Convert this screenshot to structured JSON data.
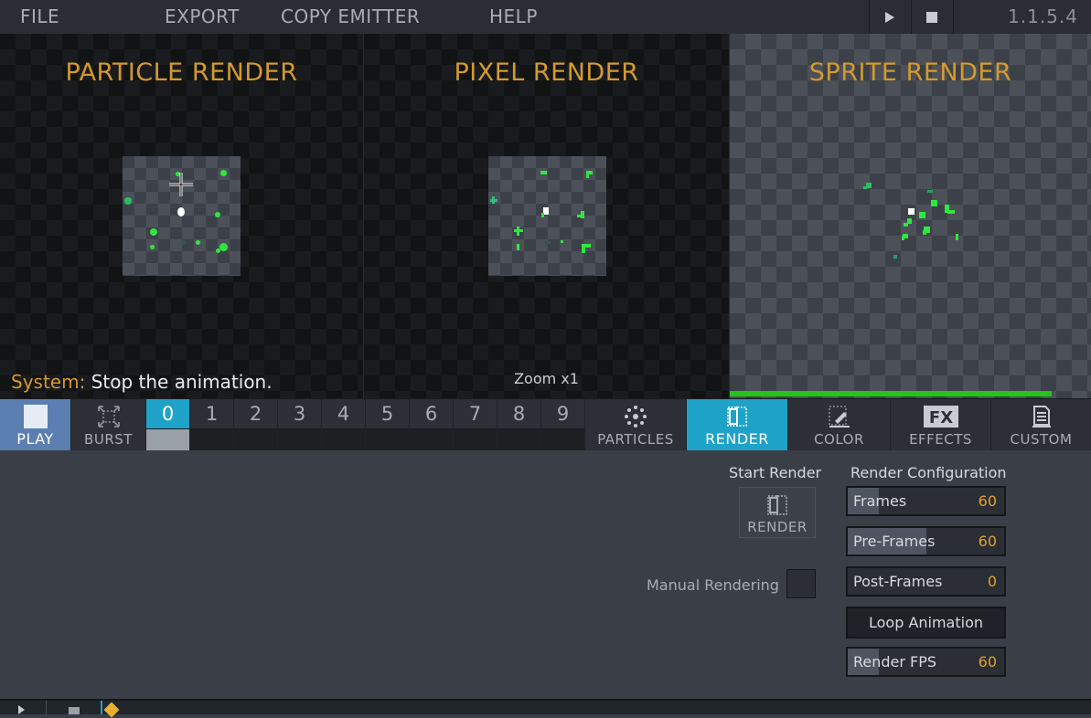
{
  "menu": {
    "file": "FILE",
    "export": "EXPORT",
    "copy_emitter": "COPY EMITTER",
    "help": "HELP",
    "version": "1.1.5.4",
    "play_icon": "play-icon",
    "stop_icon": "stop-icon"
  },
  "viewports": {
    "particle_title": "PARTICLE RENDER",
    "pixel_title": "PIXEL RENDER",
    "sprite_title": "SPRITE RENDER",
    "zoom": "Zoom x1",
    "status_label": "System:",
    "status_text": "Stop the animation.",
    "sprite_progress": 0.89
  },
  "toolbar": {
    "play": "PLAY",
    "burst": "BURST",
    "slots": [
      "0",
      "1",
      "2",
      "3",
      "4",
      "5",
      "6",
      "7",
      "8",
      "9"
    ],
    "active_slot": 0,
    "particles": "PARTICLES",
    "render": "RENDER",
    "color": "COLOR",
    "effects": "EFFECTS",
    "custom": "CUSTOM",
    "accent": "#1ea2c8",
    "play_bg": "#5a7fb0"
  },
  "panel": {
    "start_render_heading": "Start Render",
    "render_button": "RENDER",
    "config_heading": "Render Configuration",
    "manual_rendering": "Manual Rendering",
    "frames": {
      "label": "Frames",
      "value": "60",
      "fill": 0.2
    },
    "pre_frames": {
      "label": "Pre-Frames",
      "value": "60",
      "fill": 0.5
    },
    "post_frames": {
      "label": "Post-Frames",
      "value": "0",
      "fill": 0
    },
    "loop": "Loop Animation",
    "render_fps": {
      "label": "Render FPS",
      "value": "60",
      "fill": 0.2
    }
  },
  "colors": {
    "title_gold": "#d49a2c",
    "particle_green": "#2ee83e",
    "value_orange": "#e0a030"
  }
}
